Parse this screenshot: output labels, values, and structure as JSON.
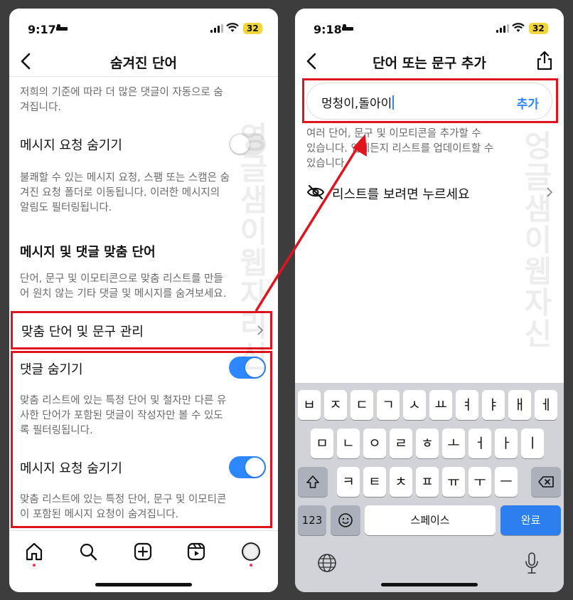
{
  "left": {
    "status": {
      "time": "9:17",
      "battery": "32"
    },
    "nav_title": "숨겨진 단어",
    "intro_text": [
      "저희의 기준에 따라 더 많은 댓글이 자동으로 숨",
      "겨집니다."
    ],
    "message_request_hide": {
      "label": "메시지 요청 숨기기",
      "toggle": "off",
      "desc": [
        "불쾌할 수 있는 메시지 요청, 스팸 또는 스캠은 숨",
        "겨진 요청 폴더로 이동됩니다. 이러한 메시지의",
        "알림도 필터링됩니다."
      ]
    },
    "custom_section": {
      "title": "메시지 및 댓글 맞춤 단어",
      "desc": [
        "단어, 문구 및 이모티콘으로 맞춤 리스트를 만들",
        "어 원치 않는 기타 댓글 및 메시지를 숨겨보세요."
      ]
    },
    "manage_row": {
      "label": "맞춤 단어 및 문구 관리"
    },
    "hide_comments": {
      "label": "댓글 숨기기",
      "toggle": "on",
      "desc": [
        "맞춤 리스트에 있는 특정 단어 및 철자만 다른 유",
        "사한 단어가 포함된 댓글이 작성자만 볼 수 있도",
        "록 필터링됩니다."
      ]
    },
    "hide_requests": {
      "label": "메시지 요청 숨기기",
      "toggle": "on",
      "desc": [
        "맞춤 리스트에 있는 특정 단어, 문구 및 이모티콘",
        "이 포함된 메시지 요청이 숨겨집니다."
      ]
    },
    "tabs": [
      "home-icon",
      "search-icon",
      "create-icon",
      "reels-icon",
      "profile-icon"
    ]
  },
  "right": {
    "status": {
      "time": "9:18",
      "battery": "32"
    },
    "nav_title": "단어 또는 문구 추가",
    "input": {
      "value": "멍청이,돌아이",
      "add_label": "추가"
    },
    "helper_text": [
      "여러 단어, 문구 및 이모티콘을 추가할 수",
      "있습니다. 언제든지 리스트를 업데이트할 수",
      "있습니다."
    ],
    "view_list": {
      "label": "리스트를 보려면 누르세요"
    },
    "keyboard": {
      "row1": [
        "ㅂ",
        "ㅈ",
        "ㄷ",
        "ㄱ",
        "ㅅ",
        "ㅛ",
        "ㅕ",
        "ㅑ",
        "ㅐ",
        "ㅔ"
      ],
      "row2": [
        "ㅁ",
        "ㄴ",
        "ㅇ",
        "ㄹ",
        "ㅎ",
        "ㅗ",
        "ㅓ",
        "ㅏ",
        "ㅣ"
      ],
      "row3": [
        "ㅋ",
        "ㅌ",
        "ㅊ",
        "ㅍ",
        "ㅠ",
        "ㅜ",
        "ㅡ"
      ],
      "numbers_label": "123",
      "space_label": "스페이스",
      "return_label": "완료"
    }
  },
  "watermark": {
    "left": [
      "영",
      "글",
      "샘",
      "이",
      "웹",
      "자",
      "리",
      "신"
    ],
    "right": [
      "엉",
      "글",
      "샘",
      "이",
      "웹",
      "자",
      "신"
    ]
  },
  "colors": {
    "accent": "#2d88ff",
    "highlight": "#e0141e"
  }
}
